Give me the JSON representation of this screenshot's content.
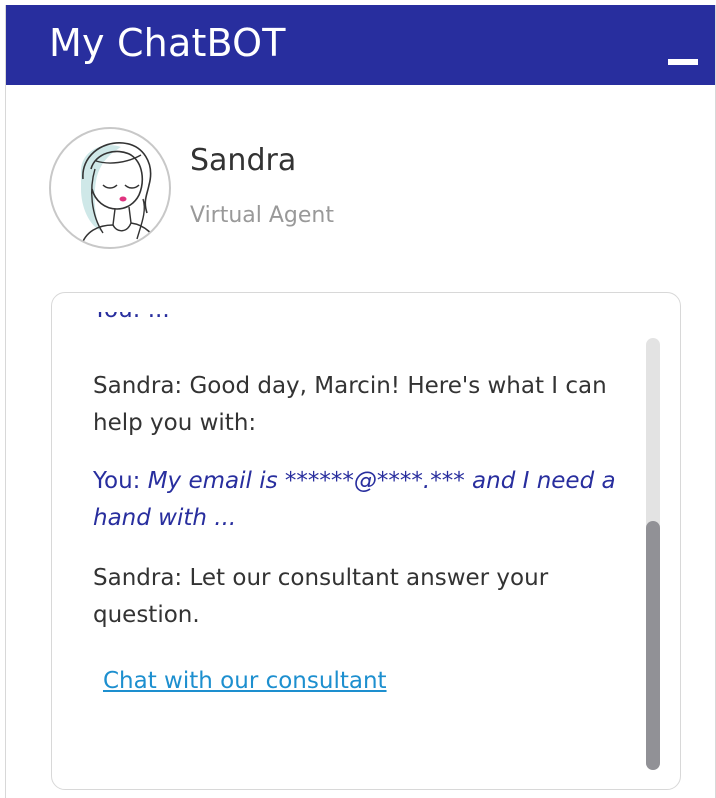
{
  "header": {
    "title": "My ChatBOT",
    "background_color": "#282e9e",
    "minimize_icon": "minimize-icon"
  },
  "agent": {
    "name": "Sandra",
    "role": "Virtual Agent",
    "avatar_icon": "agent-avatar-illustration"
  },
  "chat": {
    "clipped_top_text": "You: ...",
    "messages": [
      {
        "sender": "Sandra:",
        "text": " Good day, Marcin! Here's what I can help you with:"
      },
      {
        "sender": "You:",
        "text": " My email is ******@****.*** and I need a hand with ..."
      },
      {
        "sender": "Sandra:",
        "text": " Let our consultant answer your question."
      }
    ],
    "link_label": "Chat with our consultant",
    "link_color": "#1d8fcf",
    "user_text_color": "#282e9e"
  }
}
